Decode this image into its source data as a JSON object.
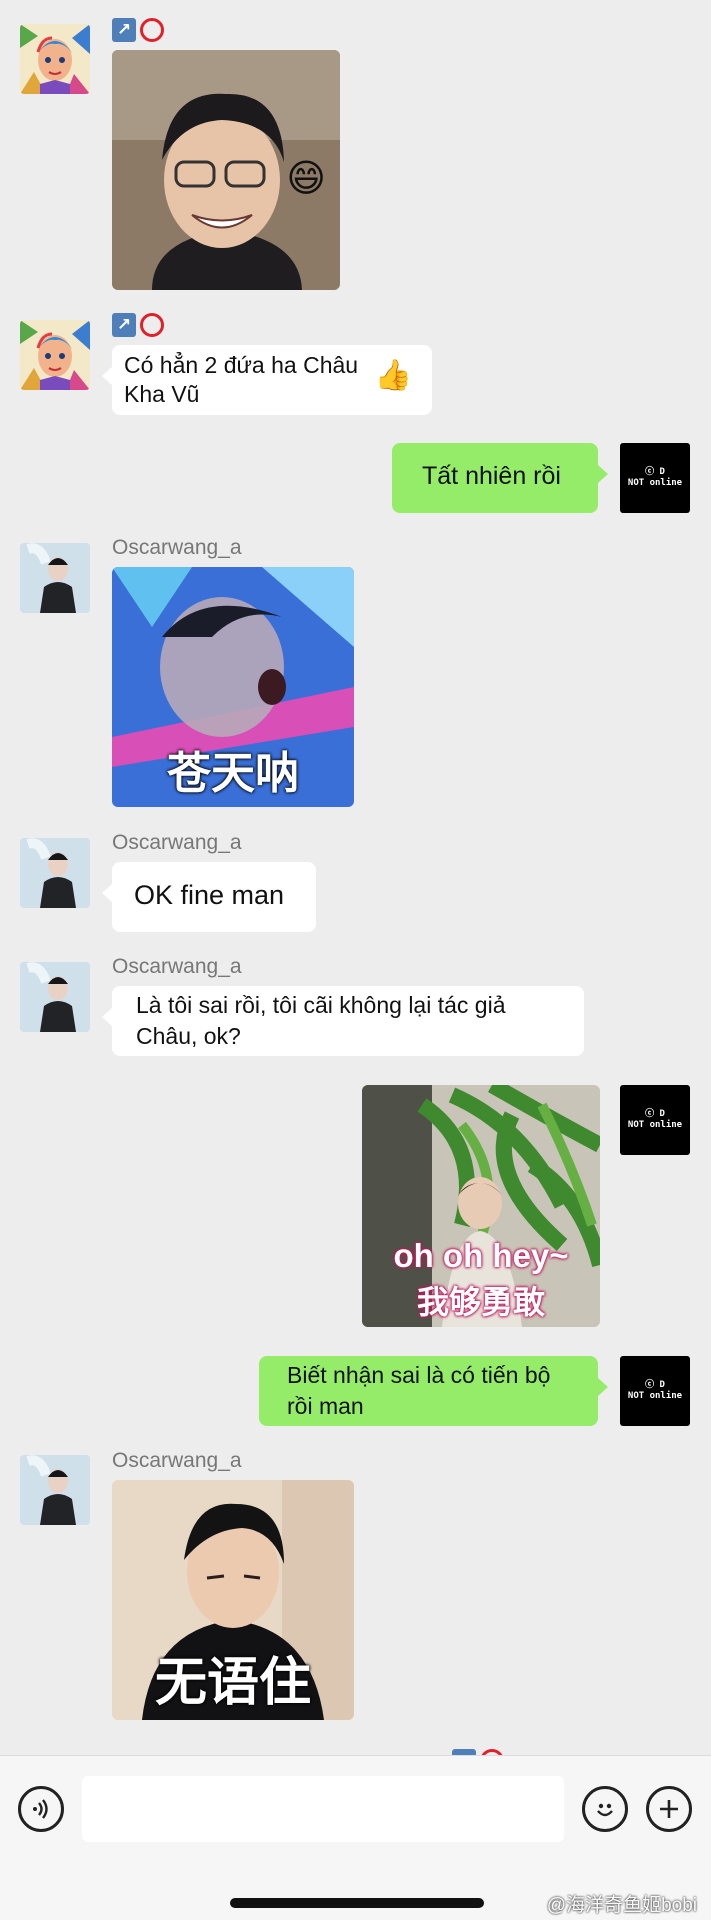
{
  "messages": [
    {
      "sender": "",
      "type": "sticker",
      "emoji": "😄"
    },
    {
      "sender": "",
      "type": "text",
      "text_line1": "Có hẳn 2 đứa ha Châu",
      "text_line2": "Kha Vũ",
      "emoji": "👍"
    },
    {
      "sender": "me",
      "type": "text",
      "text": "Tất nhiên rồi"
    },
    {
      "sender": "Oscarwang_a",
      "type": "sticker",
      "caption": "苍天呐"
    },
    {
      "sender": "Oscarwang_a",
      "type": "text",
      "text": "OK fine man"
    },
    {
      "sender": "Oscarwang_a",
      "type": "text",
      "text_line1": "Là tôi sai rồi, tôi cãi không lại tác giả",
      "text_line2": "Châu, ok?"
    },
    {
      "sender": "me",
      "type": "sticker",
      "caption_line1": "oh oh hey~",
      "caption_line2": "我够勇敢"
    },
    {
      "sender": "me",
      "type": "text",
      "text_line1": "Biết nhận sai là có tiến bộ",
      "text_line2": "rồi man"
    },
    {
      "sender": "Oscarwang_a",
      "type": "sticker",
      "caption": "无语住"
    }
  ],
  "my_avatar": {
    "line1": "ⓒ D",
    "line2": "NOT online"
  },
  "badges": {
    "arrow": "↗",
    "colors": {
      "arrow": "#4f7fb8",
      "ring": "#e0212a"
    }
  },
  "input_bar": {
    "placeholder": "",
    "voice_icon": "voice-icon",
    "emoji_icon": "emoji-icon",
    "plus_icon": "plus-icon"
  },
  "watermark": "@海洋奇鱼姬bobi",
  "colors": {
    "background": "#ededed",
    "outgoing_bubble": "#95ec69",
    "incoming_bubble": "#ffffff"
  }
}
